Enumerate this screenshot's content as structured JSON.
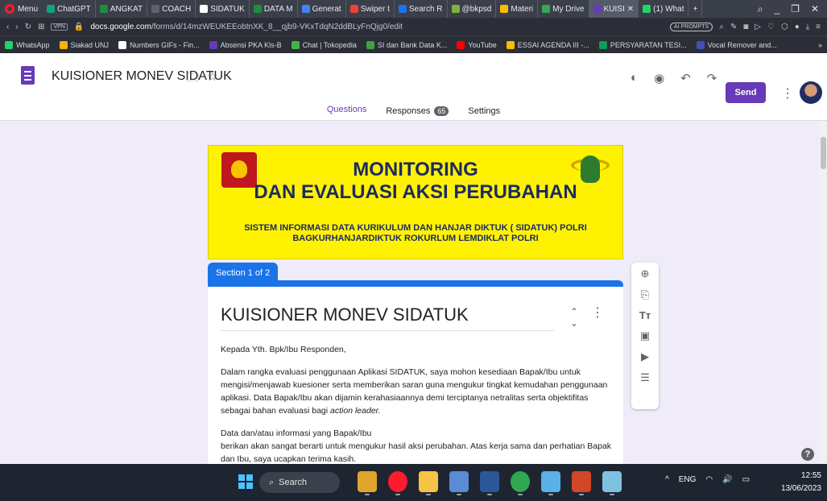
{
  "browser": {
    "menu_label": "Menu",
    "tabs": [
      {
        "label": "ChatGPT",
        "color": "#10a37f"
      },
      {
        "label": "ANGKAT",
        "color": "#1e8e3e"
      },
      {
        "label": "COACH",
        "color": "#5f6368"
      },
      {
        "label": "SIDATUK",
        "color": "#ffffff"
      },
      {
        "label": "DATA M",
        "color": "#1e8e3e"
      },
      {
        "label": "Generat",
        "color": "#4285f4"
      },
      {
        "label": "Swiper t",
        "color": "#ea4335"
      },
      {
        "label": "Search R",
        "color": "#1a73e8"
      },
      {
        "label": "@bkpsd",
        "color": "#7cb342"
      },
      {
        "label": "Materi",
        "color": "#fbbc04"
      },
      {
        "label": "My Drive",
        "color": "#34a853"
      },
      {
        "label": "KUISI",
        "color": "#673ab7",
        "active": true
      },
      {
        "label": "(1) What",
        "color": "#25d366"
      }
    ],
    "new_tab_label": "+",
    "url_domain": "docs.google.com",
    "url_path": "/forms/d/14mzWEUKEEobtnXK_8__qjb9-VKxTdqN2ddBLyFnQjg0/edit",
    "vpn_label": "VPN",
    "aiprompts_label": "AI PROMPTS",
    "bookmarks": [
      {
        "label": "WhatsApp",
        "color": "#25d366"
      },
      {
        "label": "Siakad UNJ",
        "color": "#f4b400"
      },
      {
        "label": "Numbers GIFs - Fin...",
        "color": "#ffffff"
      },
      {
        "label": "Absensi PKA Kls-B",
        "color": "#673ab7"
      },
      {
        "label": "Chat | Tokopedia",
        "color": "#42b549"
      },
      {
        "label": "SI dan Bank Data K...",
        "color": "#43a047"
      },
      {
        "label": "YouTube",
        "color": "#ff0000"
      },
      {
        "label": "ESSAI AGENDA III -...",
        "color": "#fbbc04"
      },
      {
        "label": "PERSYARATAN TESI...",
        "color": "#0f9d58"
      },
      {
        "label": "Vocal Remover and...",
        "color": "#3f51b5"
      }
    ]
  },
  "forms": {
    "doc_title": "KUISIONER MONEV SIDATUK",
    "send_label": "Send",
    "tabs": [
      {
        "label": "Questions",
        "active": true
      },
      {
        "label": "Responses",
        "count": "65"
      },
      {
        "label": "Settings"
      }
    ],
    "banner": {
      "title_line1": "MONITORING",
      "title_line2": "DAN EVALUASI AKSI PERUBAHAN",
      "subtitle_line1": "SISTEM INFORMASI DATA KURIKULUM DAN HANJAR DIKTUK ( SIDATUK) POLRI",
      "subtitle_line2": "BAGKURHANJARDIKTUK ROKURLUM LEMDIKLAT POLRI"
    },
    "section_label": "Section 1 of 2",
    "card": {
      "title": "KUISIONER MONEV SIDATUK",
      "greeting": "Kepada Yth. Bpk/Ibu Responden,",
      "paragraph1": "Dalam rangka evaluasi penggunaan  Aplikasi SIDATUK, saya mohon kesediaan Bapak/Ibu untuk mengisi/menjawab kuesioner serta memberikan saran guna mengukur tingkat kemudahan penggunaan aplikasi. Data Bapak/Ibu akan dijamin kerahasiaannya demi terciptanya netralitas serta objektifitas sebagai bahan evaluasi bagi",
      "paragraph1_italic": "action leader.",
      "paragraph2_line1": "Data dan/atau informasi yang Bapak/Ibu",
      "paragraph2_line2": "berikan akan sangat berarti untuk mengukur hasil aksi perubahan. Atas kerja sama dan perhatian Bapak dan Ibu, saya ucapkan terima kasih."
    },
    "accent_color": "#673ab7",
    "section_color": "#1a73e8"
  },
  "taskbar": {
    "search_label": "Search",
    "lang": "ENG",
    "time": "12:55",
    "date": "13/06/2023"
  }
}
